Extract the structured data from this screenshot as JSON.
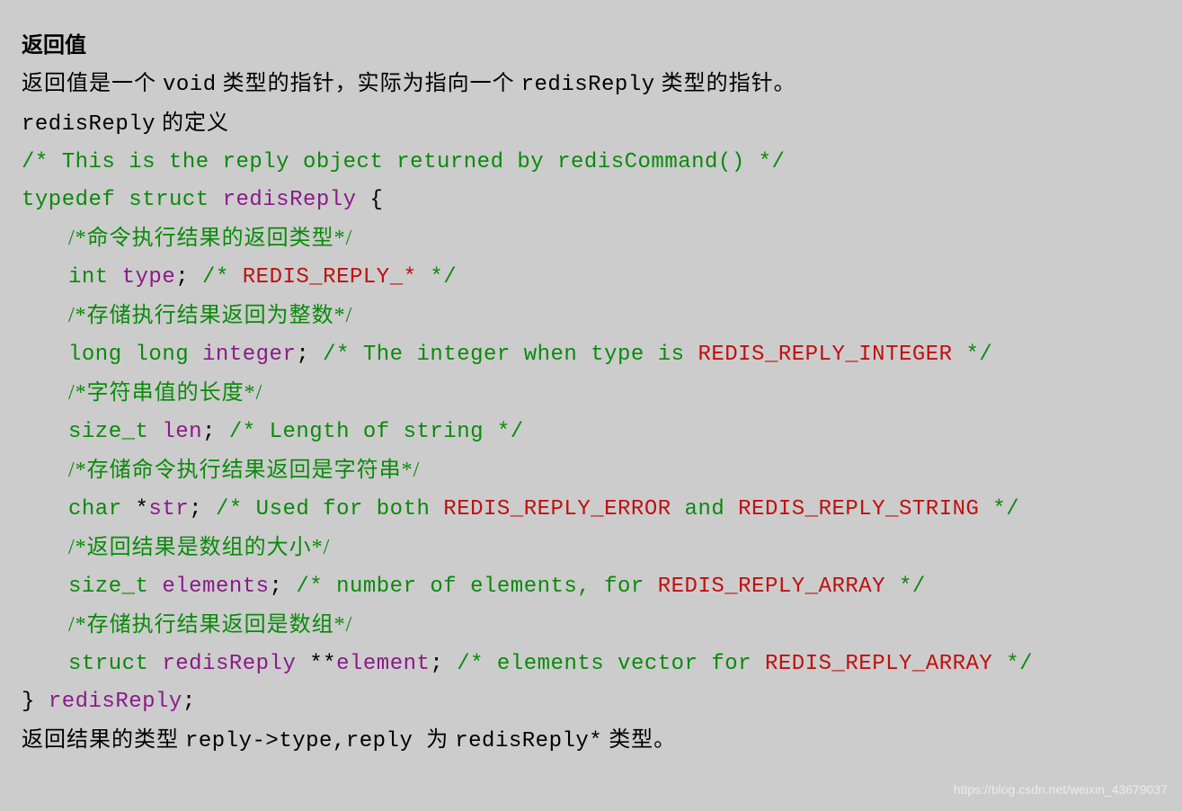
{
  "heading": "返回值",
  "intro1_pre": "返回值是一个 ",
  "intro1_void": "void",
  "intro1_mid": " 类型的指针，实际为指向一个 ",
  "intro1_rr": "redisReply",
  "intro1_post": " 类型的指针。",
  "intro2_pre": "redisReply",
  "intro2_post": " 的定义",
  "code": {
    "c1": "/* This is the reply object returned by redisCommand() */",
    "typedef": "typedef",
    "struct": "struct",
    "rr": "redisReply",
    "lb": " {",
    "cm_type": "/*命令执行结果的返回类型*/",
    "t_int": "int",
    "id_type": "type",
    "semi": ";",
    "c_type": "/* ",
    "c_type_const": "REDIS_REPLY_*",
    "c_type_end": " */",
    "cm_int": "/*存储执行结果返回为整数*/",
    "t_ll": "long long",
    "id_integer": "integer",
    "c_int_pre": "/* The integer when type is ",
    "c_int_const": "REDIS_REPLY_INTEGER",
    "c_int_end": " */",
    "cm_len": "/*字符串值的长度*/",
    "t_sizet": "size_t",
    "id_len": "len",
    "c_len": "/* Length of string */",
    "cm_str": "/*存储命令执行结果返回是字符串*/",
    "t_char": "char",
    "star": "*",
    "id_str": "str",
    "c_str_pre": "/* Used for both ",
    "c_str_c1": "REDIS_REPLY_ERROR",
    "c_str_and": " and ",
    "c_str_c2": "REDIS_REPLY_STRING",
    "c_str_end": " */",
    "cm_elnum": "/*返回结果是数组的大小*/",
    "id_elements": "elements",
    "c_eln_pre": "/* number of elements, for ",
    "c_eln_const": "REDIS_REPLY_ARRAY",
    "c_eln_end": " */",
    "cm_elv": "/*存储执行结果返回是数组*/",
    "t_struct": "struct",
    "dstar": "**",
    "id_element": "element",
    "c_elv_pre": "/* elements vector for ",
    "c_elv_const": "REDIS_REPLY_ARRAY",
    "c_elv_end": " */",
    "rb": "}",
    "rr2": "redisReply"
  },
  "outro_pre": "返回结果的类型 ",
  "outro_expr": "reply->type,reply ",
  "outro_mid": "为 ",
  "outro_t": "redisReply*",
  "outro_post": " 类型。",
  "watermark": "https://blog.csdn.net/weixin_43679037"
}
